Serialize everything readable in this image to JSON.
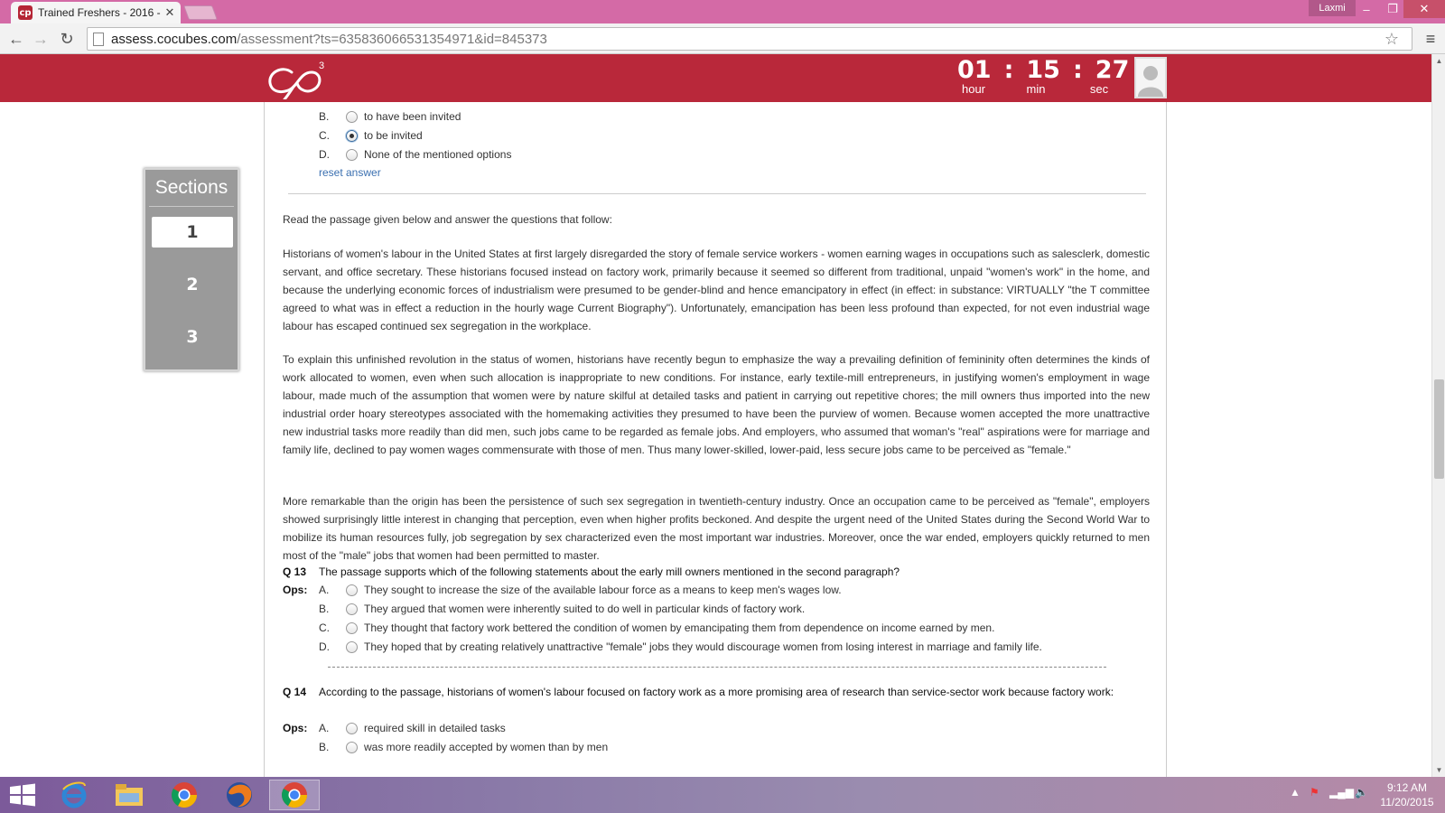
{
  "browser": {
    "tab_title": "Trained Freshers - 2016 - ",
    "tab_favicon_text": "cp",
    "user_badge": "Laxmi",
    "url_host": "assess.cocubes.com",
    "url_path": "/assessment?ts=635836066531354971&id=845373"
  },
  "timer": {
    "hours": "01",
    "minutes": "15",
    "seconds": "27",
    "hour_label": "hour",
    "min_label": "min",
    "sec_label": "sec",
    "separator": ":"
  },
  "logo": {
    "superscript": "3"
  },
  "sections": {
    "title": "Sections",
    "items": [
      {
        "label": "1",
        "active": true
      },
      {
        "label": "2",
        "active": false
      },
      {
        "label": "3",
        "active": false
      }
    ]
  },
  "prev_question": {
    "options": [
      {
        "letter": "B.",
        "text": "to have been invited",
        "checked": false
      },
      {
        "letter": "C.",
        "text": "to be invited",
        "checked": true
      },
      {
        "letter": "D.",
        "text": "None of the mentioned options",
        "checked": false
      }
    ],
    "reset_label": "reset answer"
  },
  "passage": {
    "intro": "Read the passage given below and answer the questions that follow:",
    "paragraphs": [
      "Historians of women's labour in the United States at first largely disregarded the story of female service workers - women earning wages in occupations such as salesclerk, domestic servant, and office secretary. These historians focused instead on factory work, primarily because it seemed so different from traditional, unpaid \"women's work\" in the home, and because the underlying economic forces of industrialism were presumed to be gender-blind and hence emancipatory in effect (in effect: in substance: VIRTUALLY \"the T committee agreed to what was in effect a reduction in the hourly wage Current Biography\"). Unfortunately, emancipation has been less profound than expected, for not even industrial wage labour has escaped continued sex segregation in the workplace.",
      "To explain this unfinished revolution in the status of women, historians have recently begun to emphasize the way a prevailing definition of femininity often determines the kinds of work allocated to women, even when such allocation is inappropriate to new conditions. For instance, early textile-mill entrepreneurs, in justifying women's employment in wage labour, made much of the assumption that women were by nature skilful at detailed tasks and patient in carrying out repetitive chores; the mill owners thus imported into the new industrial order hoary stereotypes associated with the homemaking activities they presumed to have been the purview of women. Because women accepted the more unattractive new industrial tasks more readily than did men, such jobs came to be regarded as female jobs. And employers, who assumed that woman's \"real\" aspirations were for marriage and family life, declined to pay women wages commensurate with those of men. Thus many lower-skilled, lower-paid, less secure jobs came to be perceived as \"female.\"",
      "More remarkable than the origin has been the persistence of such sex segregation in twentieth-century industry. Once an occupation came to be perceived as \"female\", employers showed surprisingly little interest in changing that perception, even when higher profits beckoned. And despite the urgent need of the United States during the Second World War to mobilize its human resources fully, job segregation by sex characterized even the most important war industries. Moreover, once the war ended, employers quickly returned to men most of the \"male\" jobs that women had been permitted to master."
    ]
  },
  "q13": {
    "label": "Q 13",
    "text": "The passage supports which of the following statements about the early mill owners mentioned in the second paragraph?",
    "ops_label": "Ops:",
    "options": [
      {
        "letter": "A.",
        "text": "They sought to increase the size of the available labour force as a means to keep men's wages low."
      },
      {
        "letter": "B.",
        "text": "They argued that women were inherently suited to do well in particular kinds of factory work."
      },
      {
        "letter": "C.",
        "text": "They thought that factory work bettered the condition of women by emancipating them from dependence on income earned by men."
      },
      {
        "letter": "D.",
        "text": "They hoped that by creating relatively unattractive \"female\" jobs they would discourage women from losing interest in marriage and family life."
      }
    ]
  },
  "q14": {
    "label": "Q 14",
    "text": "According to the passage, historians of women's labour focused on factory work as a more promising area of research than service-sector work because factory work:",
    "ops_label": "Ops:",
    "options": [
      {
        "letter": "A.",
        "text": "required skill in detailed tasks"
      },
      {
        "letter": "B.",
        "text": "was more readily accepted by women than by men"
      }
    ]
  },
  "taskbar": {
    "time": "9:12 AM",
    "date": "11/20/2015"
  },
  "colors": {
    "header_red": "#b9283a",
    "chrome_pink": "#d46aa6",
    "link_blue": "#3a6fb0",
    "sections_gray": "#9a9a9a"
  }
}
